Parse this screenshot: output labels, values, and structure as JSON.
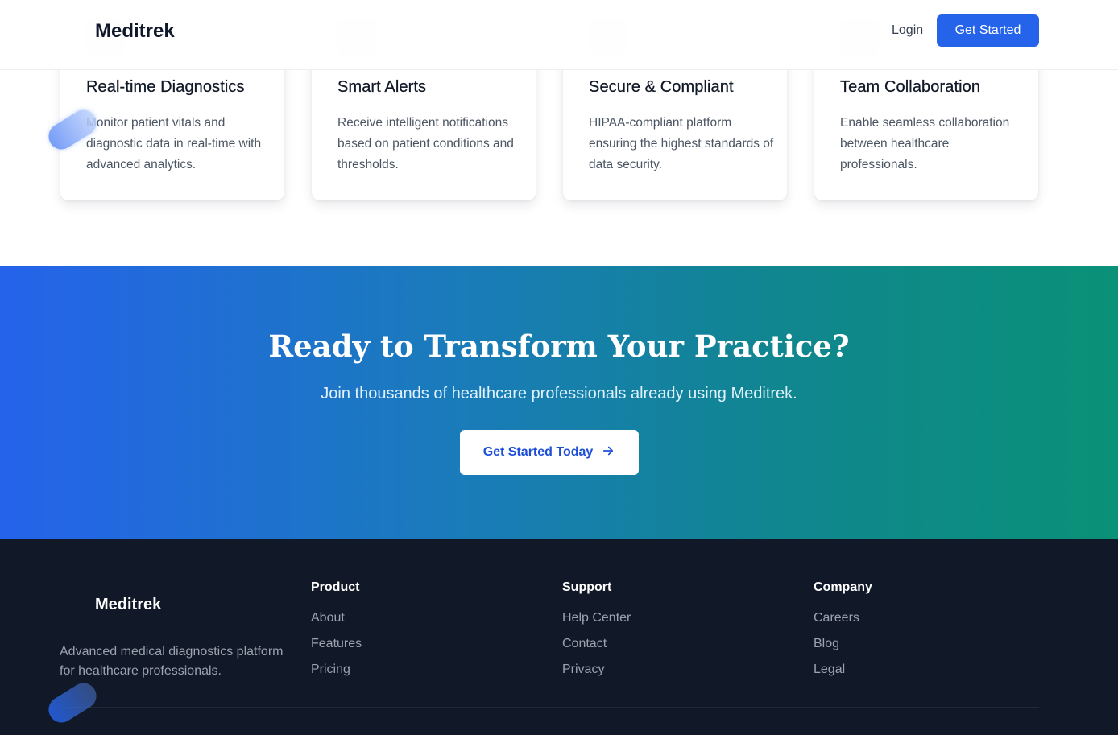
{
  "header": {
    "brand": "Meditrek",
    "login_label": "Login",
    "get_started_label": "Get Started"
  },
  "features": {
    "cards": [
      {
        "icon": "diagnostics-icon",
        "title": "Real-time Diagnostics",
        "description": "Monitor patient vitals and diagnostic data in real-time with advanced analytics."
      },
      {
        "icon": "bell-icon",
        "title": "Smart Alerts",
        "description": "Receive intelligent notifications based on patient conditions and thresholds."
      },
      {
        "icon": "shield-icon",
        "title": "Secure & Compliant",
        "description": "HIPAA-compliant platform ensuring the highest standards of data security."
      },
      {
        "icon": "users-icon",
        "title": "Team Collaboration",
        "description": "Enable seamless collaboration between healthcare professionals."
      }
    ]
  },
  "cta": {
    "title": "Ready to Transform Your Practice?",
    "subtitle": "Join thousands of healthcare professionals already using Meditrek.",
    "button_label": "Get Started Today",
    "button_icon": "arrow-right-icon"
  },
  "footer": {
    "brand": "Meditrek",
    "description": "Advanced medical diagnostics platform for healthcare professionals.",
    "columns": [
      {
        "heading": "Product",
        "links": [
          "About",
          "Features",
          "Pricing"
        ]
      },
      {
        "heading": "Support",
        "links": [
          "Help Center",
          "Contact",
          "Privacy"
        ]
      },
      {
        "heading": "Company",
        "links": [
          "Careers",
          "Blog",
          "Legal"
        ]
      }
    ]
  },
  "colors": {
    "primary": "#2563eb",
    "cta_gradient_start": "#2563eb",
    "cta_gradient_end": "#0a9178",
    "footer_bg": "#111827"
  }
}
